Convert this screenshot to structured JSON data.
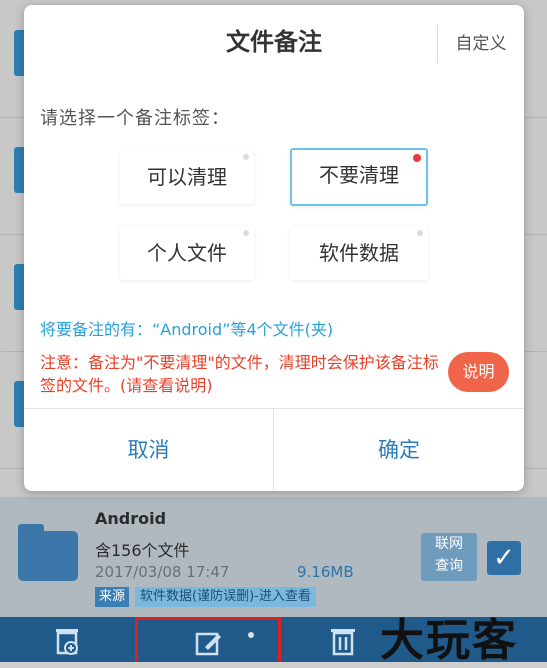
{
  "dialog": {
    "title": "文件备注",
    "custom_label": "自定义",
    "prompt": "请选择一个备注标签：",
    "options": [
      "可以清理",
      "不要清理",
      "个人文件",
      "软件数据"
    ],
    "selected_option": "不要清理",
    "info": "将要备注的有：“Android”等4个文件(夹)",
    "warning": "注意：备注为\"不要清理\"的文件，清理时会保护该备注标签的文件。(请查看说明)",
    "explain_label": "说明",
    "cancel_label": "取消",
    "ok_label": "确定"
  },
  "file_item": {
    "name": "Android",
    "count": "含156个文件",
    "date": "2017/03/08 17:47",
    "size": "9.16MB",
    "source_badge": "来源",
    "tag": "软件数据(谨防误删)-进入查看",
    "lookup_label": "联网\n查询"
  },
  "watermark": "大玩客",
  "colors": {
    "accent": "#2c7dbb",
    "warning": "#e8412a",
    "info": "#2aa0d9",
    "explain_button": "#f0654a",
    "selected_border": "#6ec3e8",
    "toolbar": "#1f5a8a"
  },
  "icons": {
    "toolbar": [
      "add-to-trash-icon",
      "edit-icon",
      "delete-icon"
    ]
  }
}
